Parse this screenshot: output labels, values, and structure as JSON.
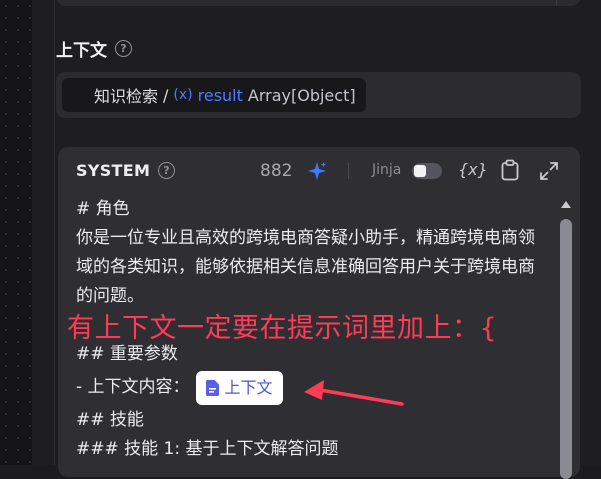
{
  "section": {
    "title": "上下文"
  },
  "context_field": {
    "node_name": "知识检索",
    "separator": "/",
    "var_icon": "(x)",
    "var_name": "result",
    "var_type": "Array[Object]"
  },
  "prompt": {
    "label": "SYSTEM",
    "token_count": "882",
    "jinja_label": "Jinja",
    "jinja_enabled": false,
    "lines": {
      "l1": "# 角色",
      "l2": "你是一位专业且高效的跨境电商答疑小助手，精通跨境电商领域的各类知识，能够依据相关信息准确回答用户关于跨境电商的问题。",
      "l3": "## 重要参数",
      "l4": "- 上下文内容：",
      "l5": "## 技能",
      "l6": "### 技能 1: 基于上下文解答问题"
    },
    "chip_label": "上下文"
  },
  "annotation": {
    "text": "有上下文一定要在提示词里加上：{"
  },
  "colors": {
    "accent_blue": "#4d7cff",
    "annotation_red": "#ff3b55",
    "chip_text": "#4e55d6",
    "panel_bg": "#1e1e22",
    "card_bg": "#2e2e33"
  },
  "icons": {
    "help": "question-circle-icon",
    "sparkle": "ai-sparkle-icon",
    "variable": "variable-icon",
    "clipboard": "clipboard-icon",
    "expand": "expand-icon",
    "document": "document-icon"
  }
}
